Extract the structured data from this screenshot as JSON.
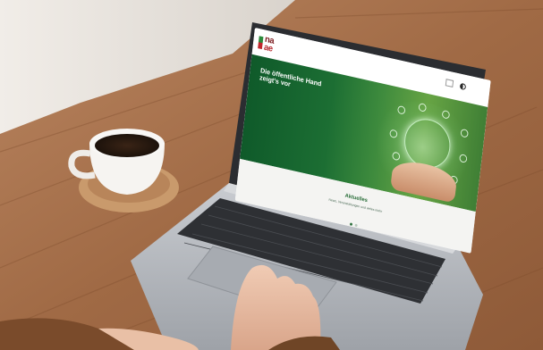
{
  "website": {
    "logo": {
      "line1": "na",
      "line2": "ae"
    },
    "nav_items": [
      "",
      "",
      "",
      ""
    ],
    "language_label": "",
    "hero": {
      "title": "Die öffentliche Hand zeigt's vor",
      "subtitle": "",
      "body": ""
    },
    "news": {
      "title": "Aktuelles",
      "subtitle": "News, Veranstaltungen und vieles mehr"
    }
  },
  "colors": {
    "hero_green": "#1c6e33",
    "news_title_green": "#2a6e3a",
    "logo_red": "#b42a2f",
    "table_wood": "#a8714a",
    "laptop_silver": "#b9bcc1"
  }
}
